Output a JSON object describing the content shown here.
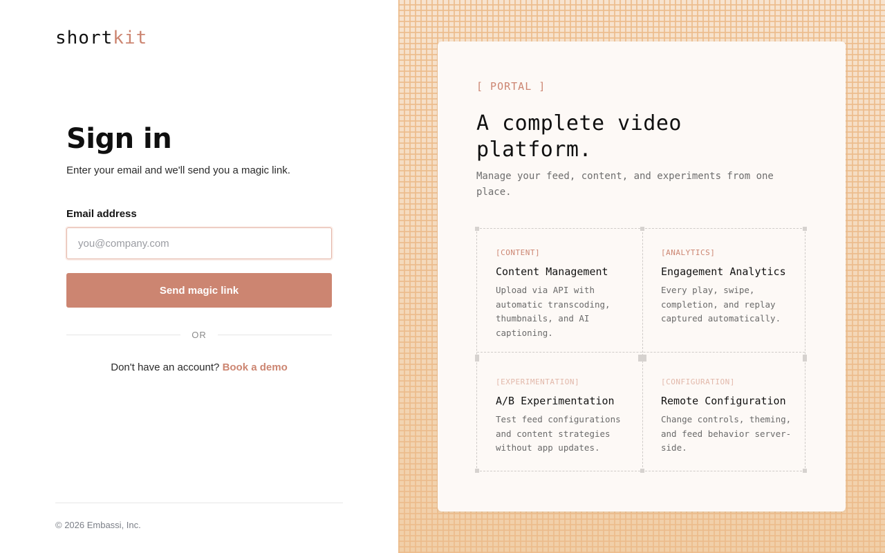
{
  "brand": {
    "name_primary": "short",
    "name_accent": "kit"
  },
  "signin": {
    "title": "Sign in",
    "subtitle": "Enter your email and we'll send you a magic link.",
    "email_label": "Email address",
    "email_placeholder": "you@company.com",
    "email_value": "",
    "submit_label": "Send magic link",
    "divider_text": "OR",
    "signup_prompt": "Don't have an account?",
    "signup_link": "Book a demo"
  },
  "footer": {
    "copyright": "© 2026 Embassi, Inc."
  },
  "portal": {
    "tag": "[ PORTAL ]",
    "headline": "A complete video platform.",
    "tagline": "Manage your feed, content, and experiments from one place.",
    "features": [
      {
        "tag": "[CONTENT]",
        "title": "Content Management",
        "description": "Upload via API with automatic transcoding, thumbnails, and AI captioning."
      },
      {
        "tag": "[ANALYTICS]",
        "title": "Engagement Analytics",
        "description": "Every play, swipe, completion, and replay captured automatically."
      },
      {
        "tag": "[EXPERIMENTATION]",
        "title": "A/B Experimentation",
        "description": "Test feed configurations and content strategies without app updates."
      },
      {
        "tag": "[CONFIGURATION]",
        "title": "Remote Configuration",
        "description": "Change controls, theming, and feed behavior server-side."
      }
    ]
  },
  "colors": {
    "accent": "#cc8571",
    "text": "#1a1a1a",
    "muted": "#6d6d6d",
    "pattern": "#f1cfa8"
  }
}
